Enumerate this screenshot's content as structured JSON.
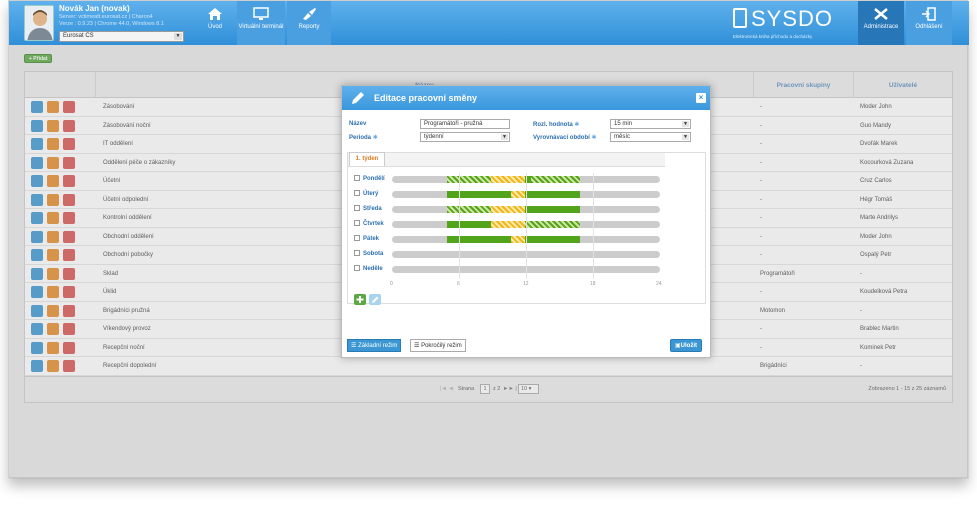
{
  "user": {
    "name": "Novák Jan (novak)",
    "server": "Server: vctimeatt.eurosat.cz | Charon4",
    "version": "Verze : 0.9.23 | Chrome 44.0, Windows 8.1",
    "company": "Eurosat CS"
  },
  "nav": {
    "home": "Úvod",
    "terminal": "Virtuální terminál",
    "reports": "Reporty",
    "admin": "Administrace",
    "logout": "Odhlášení"
  },
  "brand": {
    "name": "SYSDO",
    "tagline": "Elektronická kniha příchodu a docházky"
  },
  "toolbar": {
    "add_label": "+ Přidat"
  },
  "grid": {
    "columns": [
      "Název",
      "Pracovní skupiny",
      "Uživatelé"
    ],
    "rows": [
      {
        "name": "Zásobování",
        "groups": "-",
        "users": "Moder John"
      },
      {
        "name": "Zásobování noční",
        "groups": "-",
        "users": "Guo Mandy"
      },
      {
        "name": "IT oddělení",
        "groups": "-",
        "users": "Dvořák Marek"
      },
      {
        "name": "Oddělení péče o zákazníky",
        "groups": "-",
        "users": "Kocourková Zuzana"
      },
      {
        "name": "Účetní",
        "groups": "-",
        "users": "Cruz Carlos"
      },
      {
        "name": "Účetní odpolední",
        "groups": "-",
        "users": "Hégr Tomáš"
      },
      {
        "name": "Kontrolní oddělení",
        "groups": "-",
        "users": "Marte Andrilys"
      },
      {
        "name": "Obchodní oddělení",
        "groups": "-",
        "users": "Moder John"
      },
      {
        "name": "Obchodní pobočky",
        "groups": "-",
        "users": "Ospalý Petr"
      },
      {
        "name": "Sklad",
        "groups": "Programátoři",
        "users": "-"
      },
      {
        "name": "Úklid",
        "groups": "-",
        "users": "Koudelková Petra"
      },
      {
        "name": "Brigádníci pružná",
        "groups": "Motomon",
        "users": "-"
      },
      {
        "name": "Víkendový provoz",
        "groups": "-",
        "users": "Brablec Martin"
      },
      {
        "name": "Recepční noční",
        "groups": "-",
        "users": "Kominek Petr"
      },
      {
        "name": "Recepční dopolední",
        "groups": "Brigádníci",
        "users": "-"
      }
    ],
    "pager": {
      "page_label": "Strana",
      "page": "1",
      "of": "z 2",
      "per_page": "10",
      "summary": "Zobrazeno 1 - 15 z 25 záznamů"
    }
  },
  "modal": {
    "title": "Editace pracovní směny",
    "fields": {
      "name_label": "Název",
      "name_value": "Programátoři - pružná",
      "period_label": "Perioda",
      "period_value": "týdenní",
      "resolution_label": "Rozl. hodnota",
      "resolution_value": "15 min",
      "balance_label": "Vyrovnávací období",
      "balance_value": "měsíc"
    },
    "tab": "1. týden",
    "days": [
      "Pondělí",
      "Úterý",
      "Středa",
      "Čtvrtek",
      "Pátek",
      "Sobota",
      "Neděle"
    ],
    "ticks": [
      "0",
      "6",
      "12",
      "18",
      "24"
    ],
    "mode_basic": "Základní režim",
    "mode_advanced": "Pokročilý režim",
    "save": "Uložit"
  },
  "colors": {
    "header": "#3a97dc",
    "accent_orange": "#e07a1f",
    "work_green": "#52a51a",
    "flex_yellow": "#f1b51c"
  }
}
